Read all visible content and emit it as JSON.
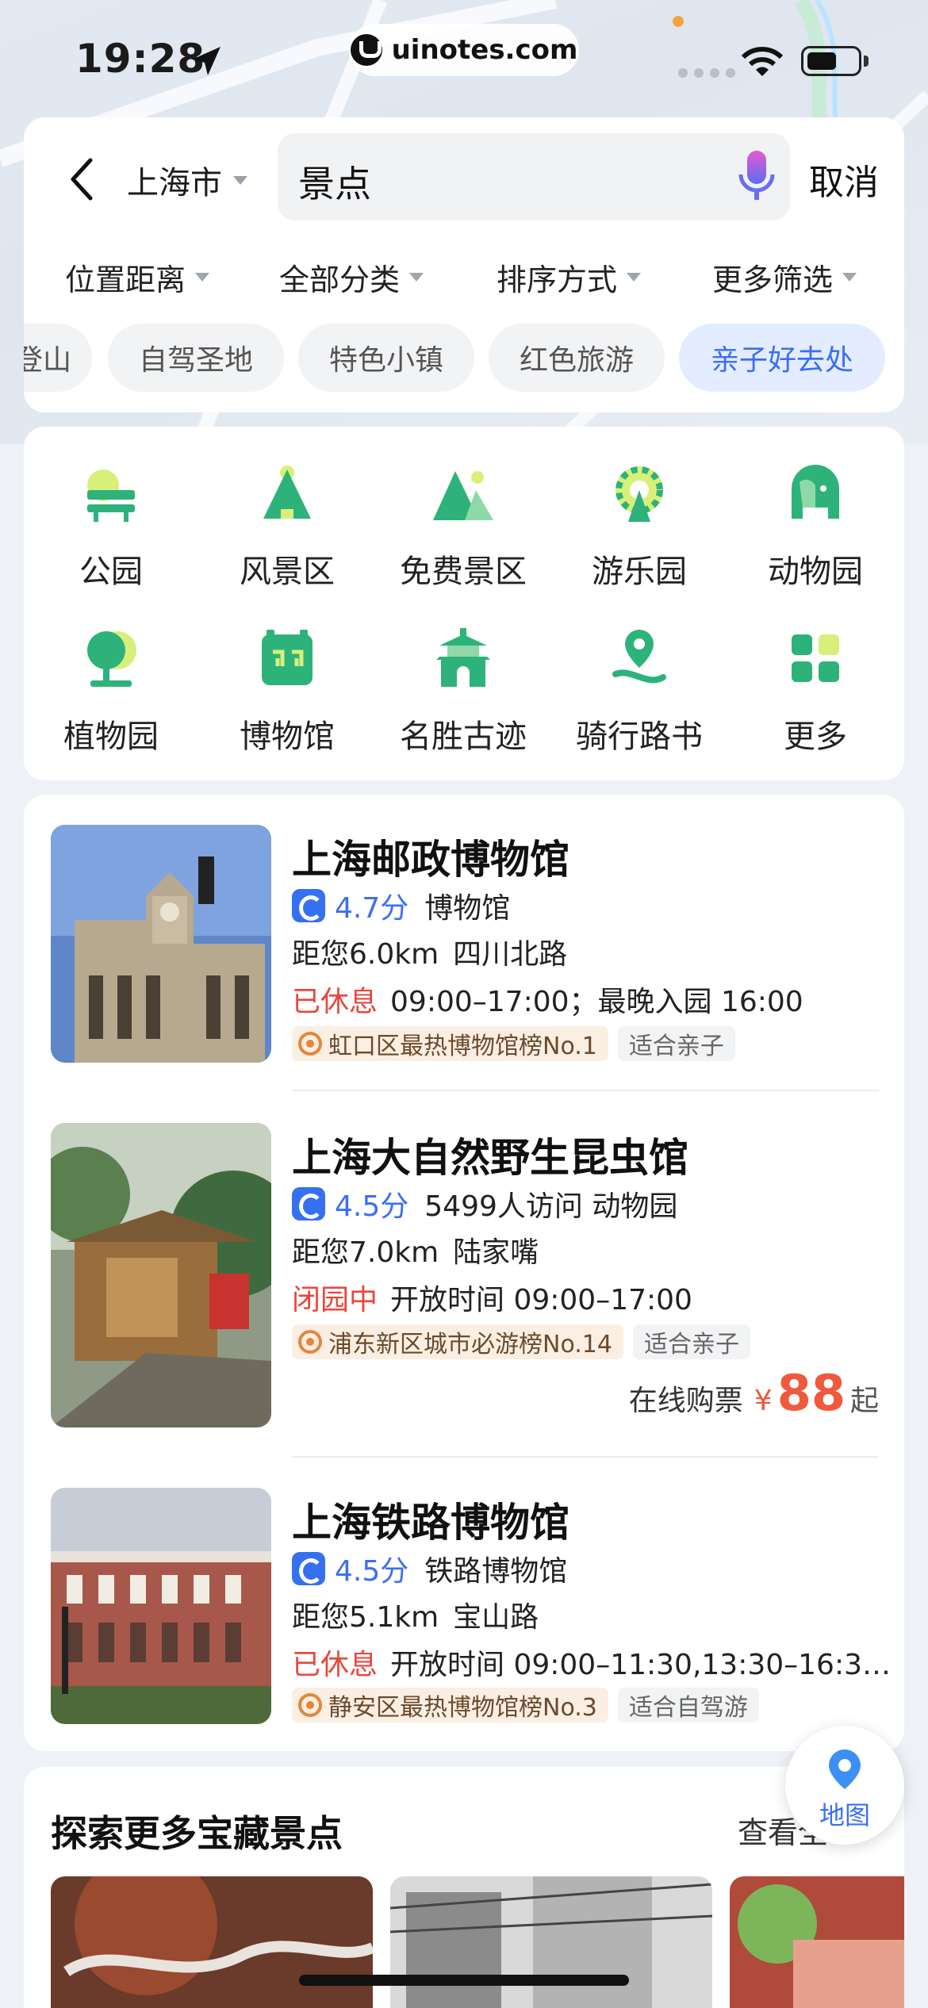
{
  "status_bar": {
    "time": "19:28",
    "url": "uinotes.com"
  },
  "search": {
    "city": "上海市",
    "query": "景点",
    "cancel_label": "取消"
  },
  "filters": [
    "位置距离",
    "全部分类",
    "排序方式",
    "更多筛选"
  ],
  "chips": [
    {
      "label": "登山",
      "active": false
    },
    {
      "label": "自驾圣地",
      "active": false
    },
    {
      "label": "特色小镇",
      "active": false
    },
    {
      "label": "红色旅游",
      "active": false
    },
    {
      "label": "亲子好去处",
      "active": true
    }
  ],
  "categories": [
    {
      "label": "公园",
      "icon": "park-bench-icon"
    },
    {
      "label": "风景区",
      "icon": "scenic-area-icon"
    },
    {
      "label": "免费景区",
      "icon": "mountain-icon"
    },
    {
      "label": "游乐园",
      "icon": "ferris-wheel-icon"
    },
    {
      "label": "动物园",
      "icon": "elephant-icon"
    },
    {
      "label": "植物园",
      "icon": "tree-icon"
    },
    {
      "label": "博物馆",
      "icon": "museum-icon"
    },
    {
      "label": "名胜古迹",
      "icon": "pagoda-icon"
    },
    {
      "label": "骑行路书",
      "icon": "route-pin-icon"
    },
    {
      "label": "更多",
      "icon": "grid-more-icon"
    }
  ],
  "results": [
    {
      "title": "上海邮政博物馆",
      "rating": "4.7分",
      "meta": "博物馆",
      "distance": "距您6.0km",
      "area": "四川北路",
      "status": "已休息",
      "hours": "09:00–17:00；最晚入园 16:00",
      "rank_tag": "虹口区最热博物馆榜No.1",
      "plain_tag": "适合亲子"
    },
    {
      "title": "上海大自然野生昆虫馆",
      "rating": "4.5分",
      "meta": "5499人访问  动物园",
      "distance": "距您7.0km",
      "area": "陆家嘴",
      "status": "闭园中",
      "hours": "开放时间 09:00–17:00",
      "rank_tag": "浦东新区城市必游榜No.14",
      "plain_tag": "适合亲子",
      "price_label": "在线购票",
      "price_currency": "¥",
      "price_value": "88",
      "price_suffix": "起"
    },
    {
      "title": "上海铁路博物馆",
      "rating": "4.5分",
      "meta": "铁路博物馆",
      "distance": "距您5.1km",
      "area": "宝山路",
      "status": "已休息",
      "hours": "开放时间 09:00–11:30,13:30–16:3…",
      "rank_tag": "静安区最热博物馆榜No.3",
      "plain_tag": "适合自驾游"
    }
  ],
  "explore": {
    "title": "探索更多宝藏景点",
    "more_label": "查看全"
  },
  "map_button": {
    "label": "地图"
  },
  "colors": {
    "accent_blue": "#3b6ef5",
    "status_red": "#e8473c",
    "category_green": "#2db37a",
    "price_orange": "#ef5a3c"
  }
}
